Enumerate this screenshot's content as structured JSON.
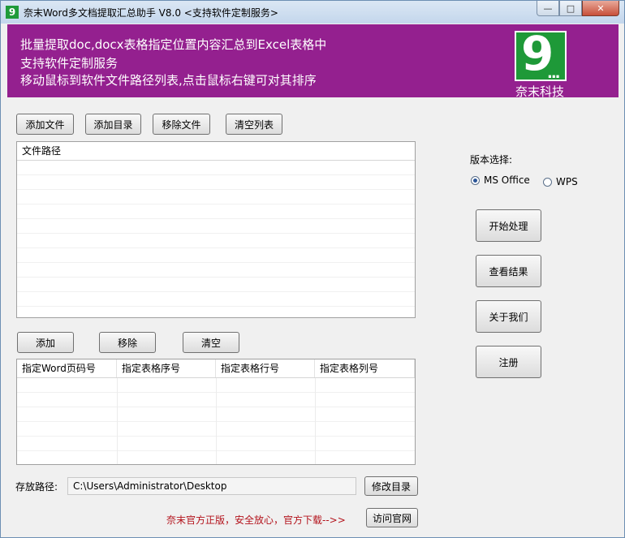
{
  "window": {
    "title": "奈末Word多文档提取汇总助手 V8.0 <支持软件定制服务>",
    "app_icon_glyph": "9",
    "min_glyph": "—",
    "max_glyph": "□",
    "close_glyph": "✕"
  },
  "banner": {
    "line1": "批量提取doc,docx表格指定位置内容汇总到Excel表格中",
    "line2": "支持软件定制服务",
    "line3": "移动鼠标到软件文件路径列表,点击鼠标右键可对其排序",
    "logo_glyph": "9",
    "logo_dots": "...",
    "logo_text": "奈末科技",
    "bg_color": "#94208f",
    "logo_color": "#1e9938"
  },
  "file_toolbar": {
    "add_file": "添加文件",
    "add_folder": "添加目录",
    "remove_file": "移除文件",
    "clear_list": "清空列表"
  },
  "file_list": {
    "columns": [
      "文件路径"
    ]
  },
  "pos_toolbar": {
    "add": "添加",
    "remove": "移除",
    "clear": "清空"
  },
  "pos_list": {
    "columns": [
      "指定Word页码号",
      "指定表格序号",
      "指定表格行号",
      "指定表格列号"
    ]
  },
  "version": {
    "label": "版本选择:",
    "options": [
      "MS Office",
      "WPS"
    ],
    "selected": "MS Office"
  },
  "actions": {
    "start": "开始处理",
    "view_results": "查看结果",
    "about": "关于我们",
    "register": "注册"
  },
  "output": {
    "label": "存放路径:",
    "path": "C:\\Users\\Administrator\\Desktop",
    "change_dir": "修改目录"
  },
  "footer": {
    "promo": "奈末官方正版，安全放心，官方下载-->>",
    "visit_site": "访问官网"
  }
}
